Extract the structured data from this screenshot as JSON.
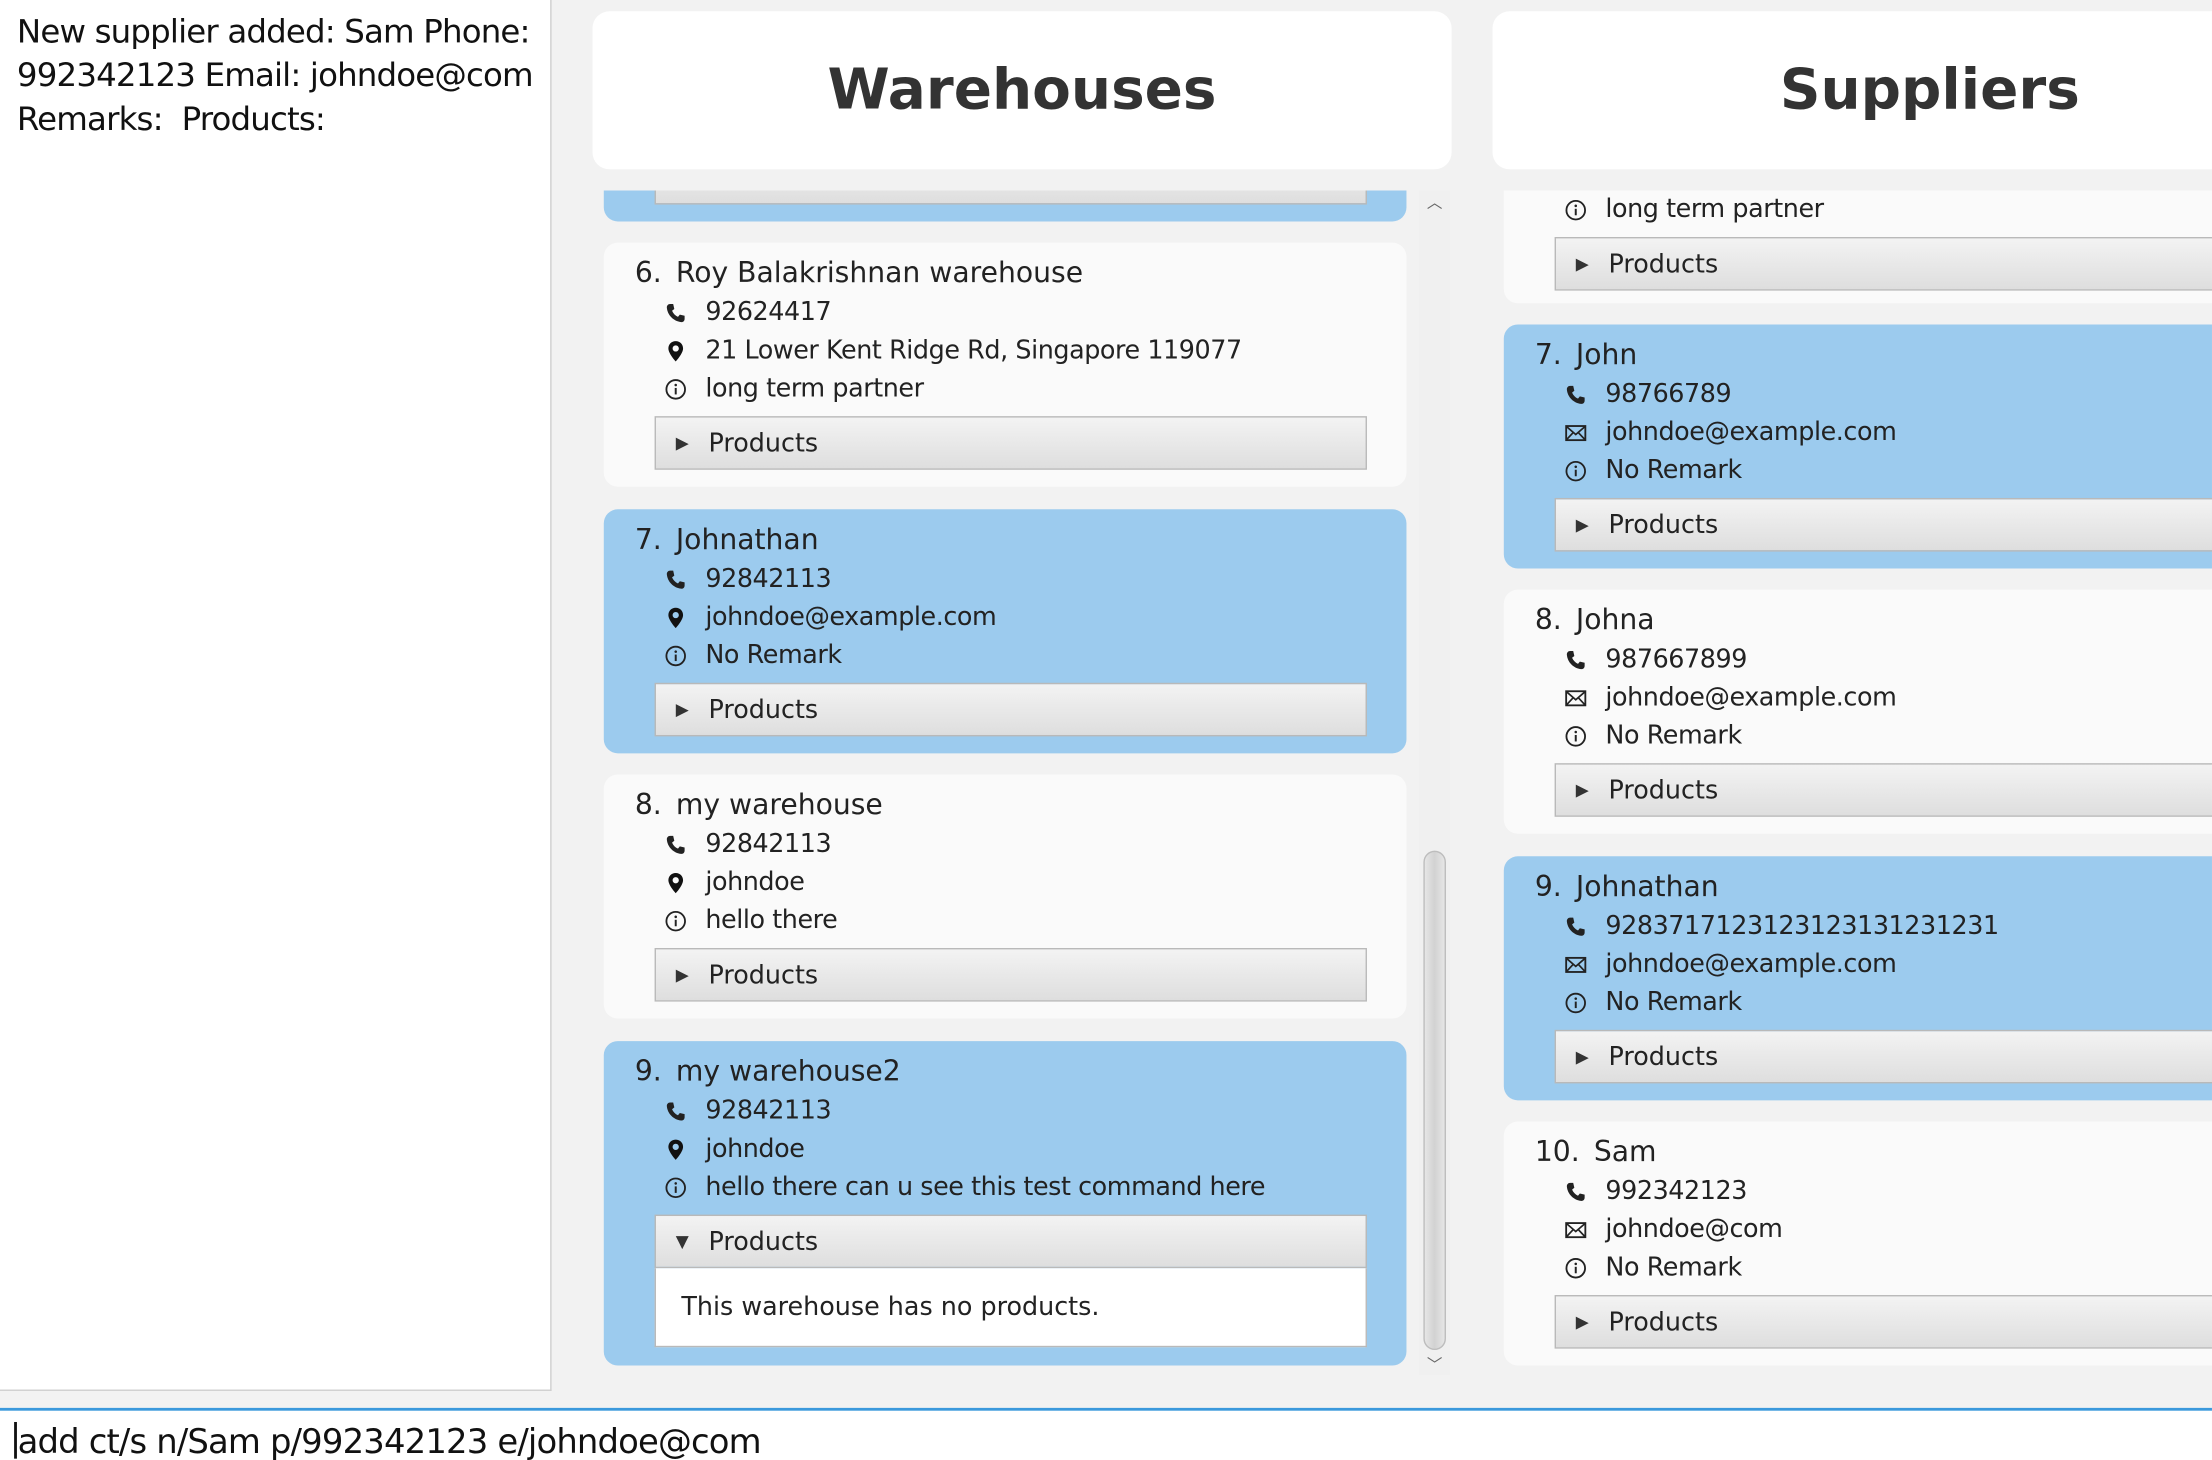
{
  "result": {
    "message": "New supplier added: Sam Phone: 992342123 Email: johndoe@com Remarks:  Products:"
  },
  "warehouses": {
    "header": "Warehouses",
    "top_partial_note": "",
    "items": [
      {
        "index": "6.",
        "name": "Roy Balakrishnan warehouse",
        "phone": "92624417",
        "address": "21 Lower Kent Ridge Rd, Singapore 119077",
        "remark": "long term partner",
        "products_label": "Products",
        "selected": false,
        "expanded": false
      },
      {
        "index": "7.",
        "name": "Johnathan",
        "phone": "92842113",
        "address": "johndoe@example.com",
        "remark": "No Remark",
        "products_label": "Products",
        "selected": true,
        "expanded": false
      },
      {
        "index": "8.",
        "name": "my warehouse",
        "phone": "92842113",
        "address": "johndoe",
        "remark": "hello there",
        "products_label": "Products",
        "selected": false,
        "expanded": false
      },
      {
        "index": "9.",
        "name": "my warehouse2",
        "phone": "92842113",
        "address": "johndoe",
        "remark": "hello there can u see this test command here",
        "products_label": "Products",
        "selected": true,
        "expanded": true,
        "products_empty": "This warehouse has no products."
      }
    ]
  },
  "suppliers": {
    "header": "Suppliers",
    "top_partial": {
      "remark": "long term partner",
      "products_label": "Products"
    },
    "items": [
      {
        "index": "7.",
        "name": "John",
        "phone": "98766789",
        "email": "johndoe@example.com",
        "remark": "No Remark",
        "products_label": "Products",
        "selected": true
      },
      {
        "index": "8.",
        "name": "Johna",
        "phone": "987667899",
        "email": "johndoe@example.com",
        "remark": "No Remark",
        "products_label": "Products",
        "selected": false
      },
      {
        "index": "9.",
        "name": "Johnathan",
        "phone": "928371712312312313123123 1",
        "email": "johndoe@example.com",
        "remark": "No Remark",
        "products_label": "Products",
        "selected": true
      },
      {
        "index": "10.",
        "name": "Sam",
        "phone": "992342123",
        "email": "johndoe@com",
        "remark": "No Remark",
        "products_label": "Products",
        "selected": false
      }
    ]
  },
  "command": {
    "value": "add ct/s n/Sam p/992342123 e/johndoe@com"
  },
  "icons": {
    "phone": "phone-icon",
    "address": "map-pin-icon",
    "email": "envelope-icon",
    "remark": "info-icon",
    "expand": "triangle-right-icon",
    "collapse": "triangle-down-icon"
  },
  "colors": {
    "selected_card": "#9ccbee",
    "card": "#fafafa",
    "command_border": "#3b99dc"
  }
}
